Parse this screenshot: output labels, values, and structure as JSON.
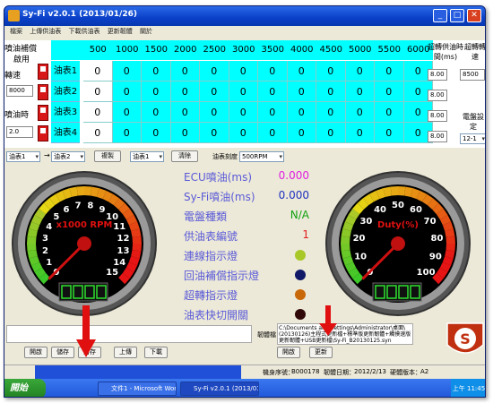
{
  "window": {
    "title": "Sy-Fi v2.0.1 (2013/01/26)"
  },
  "menu": {
    "items": [
      "檔案",
      "上傳供油表",
      "下載供油表",
      "更新韌體",
      "關於"
    ]
  },
  "table": {
    "col_headers": [
      "500",
      "1000",
      "1500",
      "2000",
      "2500",
      "3000",
      "3500",
      "4000",
      "4500",
      "5000",
      "5500",
      "6000"
    ],
    "left_header_top": "噴油補償",
    "left_header_bottom": "啟用",
    "rows": [
      {
        "label": "油表1",
        "side_label": "轉速",
        "values": [
          "0",
          "0",
          "0",
          "0",
          "0",
          "0",
          "0",
          "0",
          "0",
          "0",
          "0",
          "0"
        ]
      },
      {
        "label": "油表2",
        "side_label": "",
        "values": [
          "0",
          "0",
          "0",
          "0",
          "0",
          "0",
          "0",
          "0",
          "0",
          "0",
          "0",
          "0"
        ]
      },
      {
        "label": "油表3",
        "side_label": "噴油時",
        "values": [
          "0",
          "0",
          "0",
          "0",
          "0",
          "0",
          "0",
          "0",
          "0",
          "0",
          "0",
          "0"
        ]
      },
      {
        "label": "油表4",
        "side_label": "",
        "values": [
          "0",
          "0",
          "0",
          "0",
          "0",
          "0",
          "0",
          "0",
          "0",
          "0",
          "0",
          "0"
        ]
      }
    ],
    "left_spin_values": [
      "8000",
      "2.0"
    ],
    "right_header_1": "超轉供油時間(ms)",
    "right_header_2": "超轉轉速",
    "right_spins": [
      "8.00",
      "8.00",
      "8.00",
      "8.00"
    ],
    "overrev_rpm": "8500",
    "ecu_label": "電盤設定",
    "ecu_value": "12-1"
  },
  "controls": {
    "combo1": "油表1",
    "arrow": "→",
    "combo2": "油表2",
    "copy_button": "複製",
    "combo3": "油表1",
    "clear_button": "清除",
    "scale_label": "油表刻度",
    "scale_value": "500RPM"
  },
  "gauges": {
    "rpm_label": "x1000 RPM",
    "rpm_ticks": [
      "0",
      "1",
      "2",
      "3",
      "4",
      "5",
      "6",
      "7",
      "8",
      "9",
      "10",
      "11",
      "12",
      "13",
      "14",
      "15"
    ],
    "rpm_value": 0,
    "duty_label": "Duty(%)",
    "duty_ticks": [
      "0",
      "10",
      "20",
      "30",
      "40",
      "50",
      "60",
      "70",
      "80",
      "90",
      "100"
    ],
    "duty_value": 0
  },
  "info": {
    "ecu_injection_label": "ECU噴油(ms)",
    "ecu_injection_value": "0.000",
    "syfi_injection_label": "Sy-Fi噴油(ms)",
    "syfi_injection_value": "0.000",
    "ecu_type_label": "電盤種類",
    "ecu_type_value": "N/A",
    "fuel_map_no_label": "供油表編號",
    "fuel_map_no_value": "1",
    "lamps": [
      {
        "label": "連線指示燈",
        "color": "#a8c828"
      },
      {
        "label": "回油補償指示燈",
        "color": "#101868"
      },
      {
        "label": "超轉指示燈",
        "color": "#c86808"
      },
      {
        "label": "油表快切開關",
        "color": "#300808"
      }
    ]
  },
  "bottom": {
    "buttons_left": [
      "開啟",
      "儲存",
      "另存",
      "上傳",
      "下載"
    ],
    "update_label": "韌體檔",
    "file_path": "C:\\Documents and Settings\\Administrator\\桌面\\(20130126)主程式更新檔+標準版更新韌體+觸摸速版更新韌體+USB更新檔\\Sy-Fi_B20130125.syn",
    "buttons_right": [
      "開啟",
      "更新"
    ]
  },
  "status": {
    "serial_label": "機身序號：",
    "serial_value": "B000178",
    "update_date_label": "韌體日期：",
    "update_date_value": "2012/2/13",
    "hw_label": "硬體版本：",
    "hw_value": "A2"
  },
  "taskbar": {
    "start": "開始",
    "tasks": [
      "文件1 - Microsoft Word",
      "Sy-Fi v2.0.1 (2013/01/..."
    ],
    "clock": "上午 11:45"
  },
  "colors": {
    "cyan": "#00ffff",
    "accent_purple": "#ff00ff",
    "titlebar": "#0a3fc8",
    "redarrow": "#e01010"
  }
}
